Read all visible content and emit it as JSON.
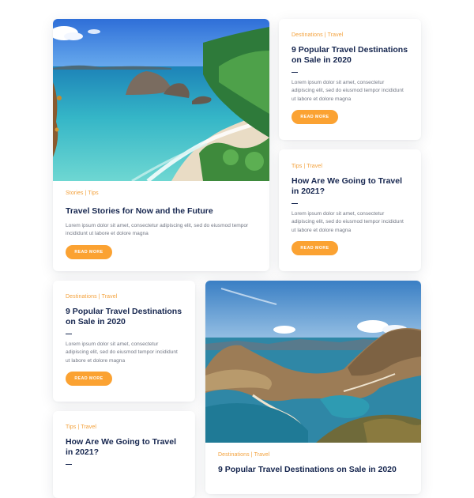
{
  "featured_beach": {
    "category": "Stories | Tips",
    "title": "Travel Stories for Now and the Future",
    "excerpt": "Lorem ipsum dolor sit amet, consectetur adipiscing elit, sed do eiusmod tempor incididunt ut labore et dolore magna",
    "button": "READ MORE"
  },
  "side_card_1": {
    "category": "Destinations | Travel",
    "title": "9 Popular Travel Destinations on Sale in 2020",
    "excerpt": "Lorem ipsum dolor sit amet, consectetur adipiscing elit, sed do eiusmod tempor incididunt ut labore et dolore magna",
    "button": "READ MORE"
  },
  "side_card_2": {
    "category": "Tips | Travel",
    "title": "How Are We Going to Travel in 2021?",
    "excerpt": "Lorem ipsum dolor sit amet, consectetur adipiscing elit, sed do eiusmod tempor incididunt ut labore et dolore magna",
    "button": "READ MORE"
  },
  "left_card_1": {
    "category": "Destinations | Travel",
    "title": "9 Popular Travel Destinations on Sale in 2020",
    "excerpt": "Lorem ipsum dolor sit amet, consectetur adipiscing elit, sed do eiusmod tempor incididunt ut labore et dolore magna",
    "button": "READ MORE"
  },
  "left_card_2": {
    "category": "Tips | Travel",
    "title": "How Are We Going to Travel in 2021?"
  },
  "featured_mountain": {
    "category": "Destinations | Travel",
    "title": "9 Popular Travel Destinations on Sale in 2020"
  },
  "colors": {
    "accent": "#fba232",
    "heading": "#16264f",
    "text": "#727784"
  }
}
